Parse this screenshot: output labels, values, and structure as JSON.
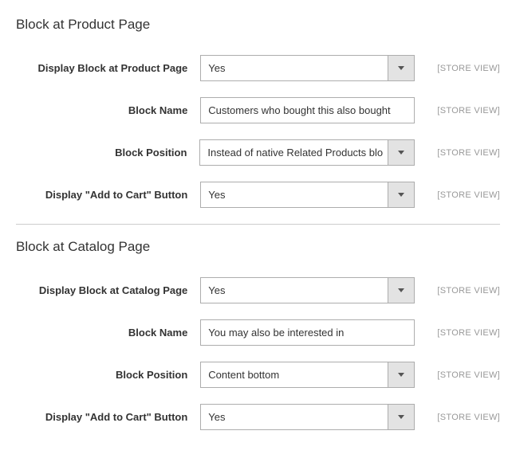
{
  "scope_label": "[STORE VIEW]",
  "sections": {
    "product": {
      "title": "Block at Product Page",
      "fields": {
        "display": {
          "label": "Display Block at Product Page",
          "value": "Yes"
        },
        "name": {
          "label": "Block Name",
          "value": "Customers who bought this also bought"
        },
        "position": {
          "label": "Block Position",
          "value": "Instead of native Related Products blo"
        },
        "addcart": {
          "label": "Display \"Add to Cart\" Button",
          "value": "Yes"
        }
      }
    },
    "catalog": {
      "title": "Block at Catalog Page",
      "fields": {
        "display": {
          "label": "Display Block at Catalog Page",
          "value": "Yes"
        },
        "name": {
          "label": "Block Name",
          "value": "You may also be interested in"
        },
        "position": {
          "label": "Block Position",
          "value": "Content bottom"
        },
        "addcart": {
          "label": "Display \"Add to Cart\" Button",
          "value": "Yes"
        }
      }
    }
  }
}
